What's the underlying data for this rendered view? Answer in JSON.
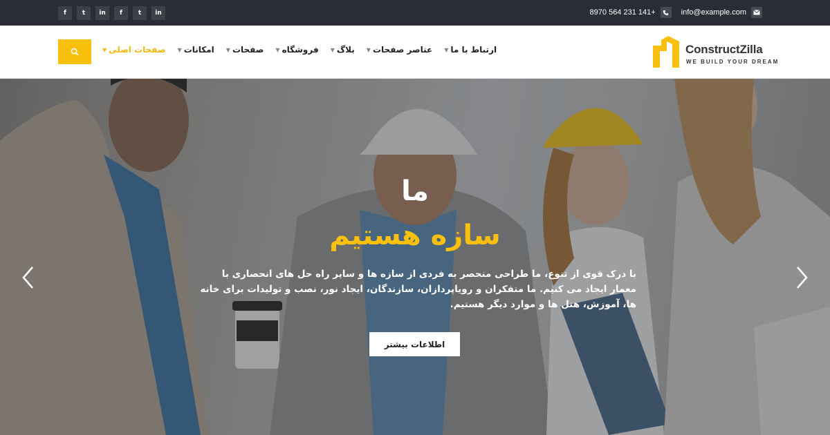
{
  "topbar": {
    "socials": [
      {
        "icon": "facebook-icon",
        "glyph": "f"
      },
      {
        "icon": "twitter-icon",
        "glyph": "t"
      },
      {
        "icon": "linkedin-icon",
        "glyph": "in"
      },
      {
        "icon": "facebook-icon",
        "glyph": "f"
      },
      {
        "icon": "twitter-icon",
        "glyph": "t"
      },
      {
        "icon": "linkedin-icon",
        "glyph": "in"
      }
    ],
    "phone": "8970 564 231 141+",
    "email": "info@example.com"
  },
  "header": {
    "logo_name": "ConstructZilla",
    "logo_tagline": "WE BUILD YOUR DREAM",
    "menu": [
      {
        "label": "صفحات اصلی",
        "active": true
      },
      {
        "label": "امکانات",
        "active": false
      },
      {
        "label": "صفحات",
        "active": false
      },
      {
        "label": "فروشگاه",
        "active": false
      },
      {
        "label": "بلاگ",
        "active": false
      },
      {
        "label": "عناصر صفحات",
        "active": false
      },
      {
        "label": "ارتباط با ما",
        "active": false
      }
    ]
  },
  "hero": {
    "title_line1": "ما",
    "title_line2": "سازه هستیم",
    "description": "با درک قوی از تنوع، ما طراحی منحصر به فردی از سازه ها و سایر راه حل های انحصاری با معمار ایجاد می کنیم. ما متفکران و رویاپردازان، سازندگان، ایجاد نور، نصب و تولیدات برای خانه ها، آموزش، هتل ها و موارد دیگر هستیم.",
    "button_label": "اطلاعات بیشتر"
  },
  "colors": {
    "accent": "#f9c10d",
    "topbar_bg": "#2a2d35"
  }
}
